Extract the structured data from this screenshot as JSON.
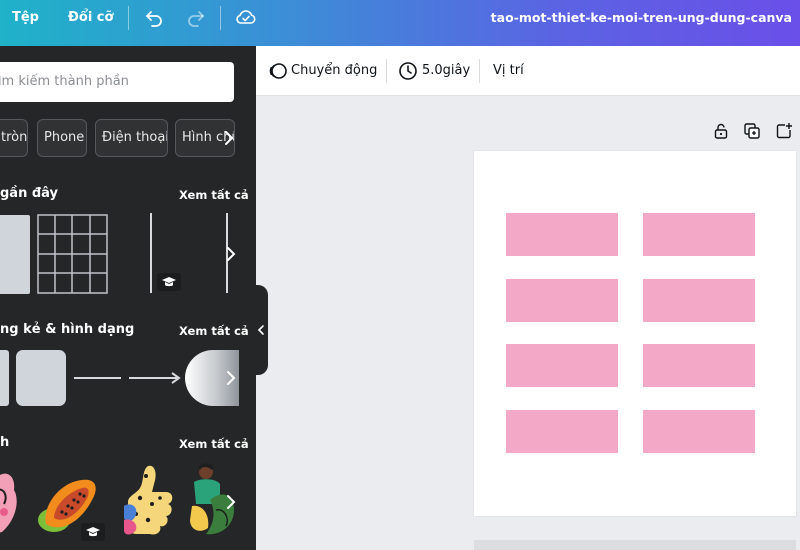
{
  "topbar": {
    "file_menu": "Tệp",
    "resize_menu": "Đổi cỡ",
    "undo_icon": "undo-icon",
    "redo_icon": "redo-icon",
    "saved_icon": "cloud-check-icon",
    "document_title": "tao-mot-thiet-ke-moi-tren-ung-dung-canva"
  },
  "panel": {
    "search_placeholder": "Tìm kiếm thành phần",
    "chips": [
      "tròn",
      "Phone",
      "Điện thoại",
      "Hình chữ"
    ],
    "sections": [
      {
        "title": "gần đây",
        "see_all": "Xem tất cả"
      },
      {
        "title": "ng kẻ & hình dạng",
        "see_all": "Xem tất cả"
      },
      {
        "title": "h",
        "see_all": "Xem tất cả"
      }
    ]
  },
  "toolbar": {
    "animate_label": "Chuyển động",
    "duration_label": "5.0giây",
    "position_label": "Vị trí"
  },
  "page_actions": [
    "lock-icon",
    "duplicate-page-icon",
    "add-page-icon"
  ],
  "canvas": {
    "grid_color": "#f4a8c7",
    "rows": 4,
    "columns": 2
  }
}
